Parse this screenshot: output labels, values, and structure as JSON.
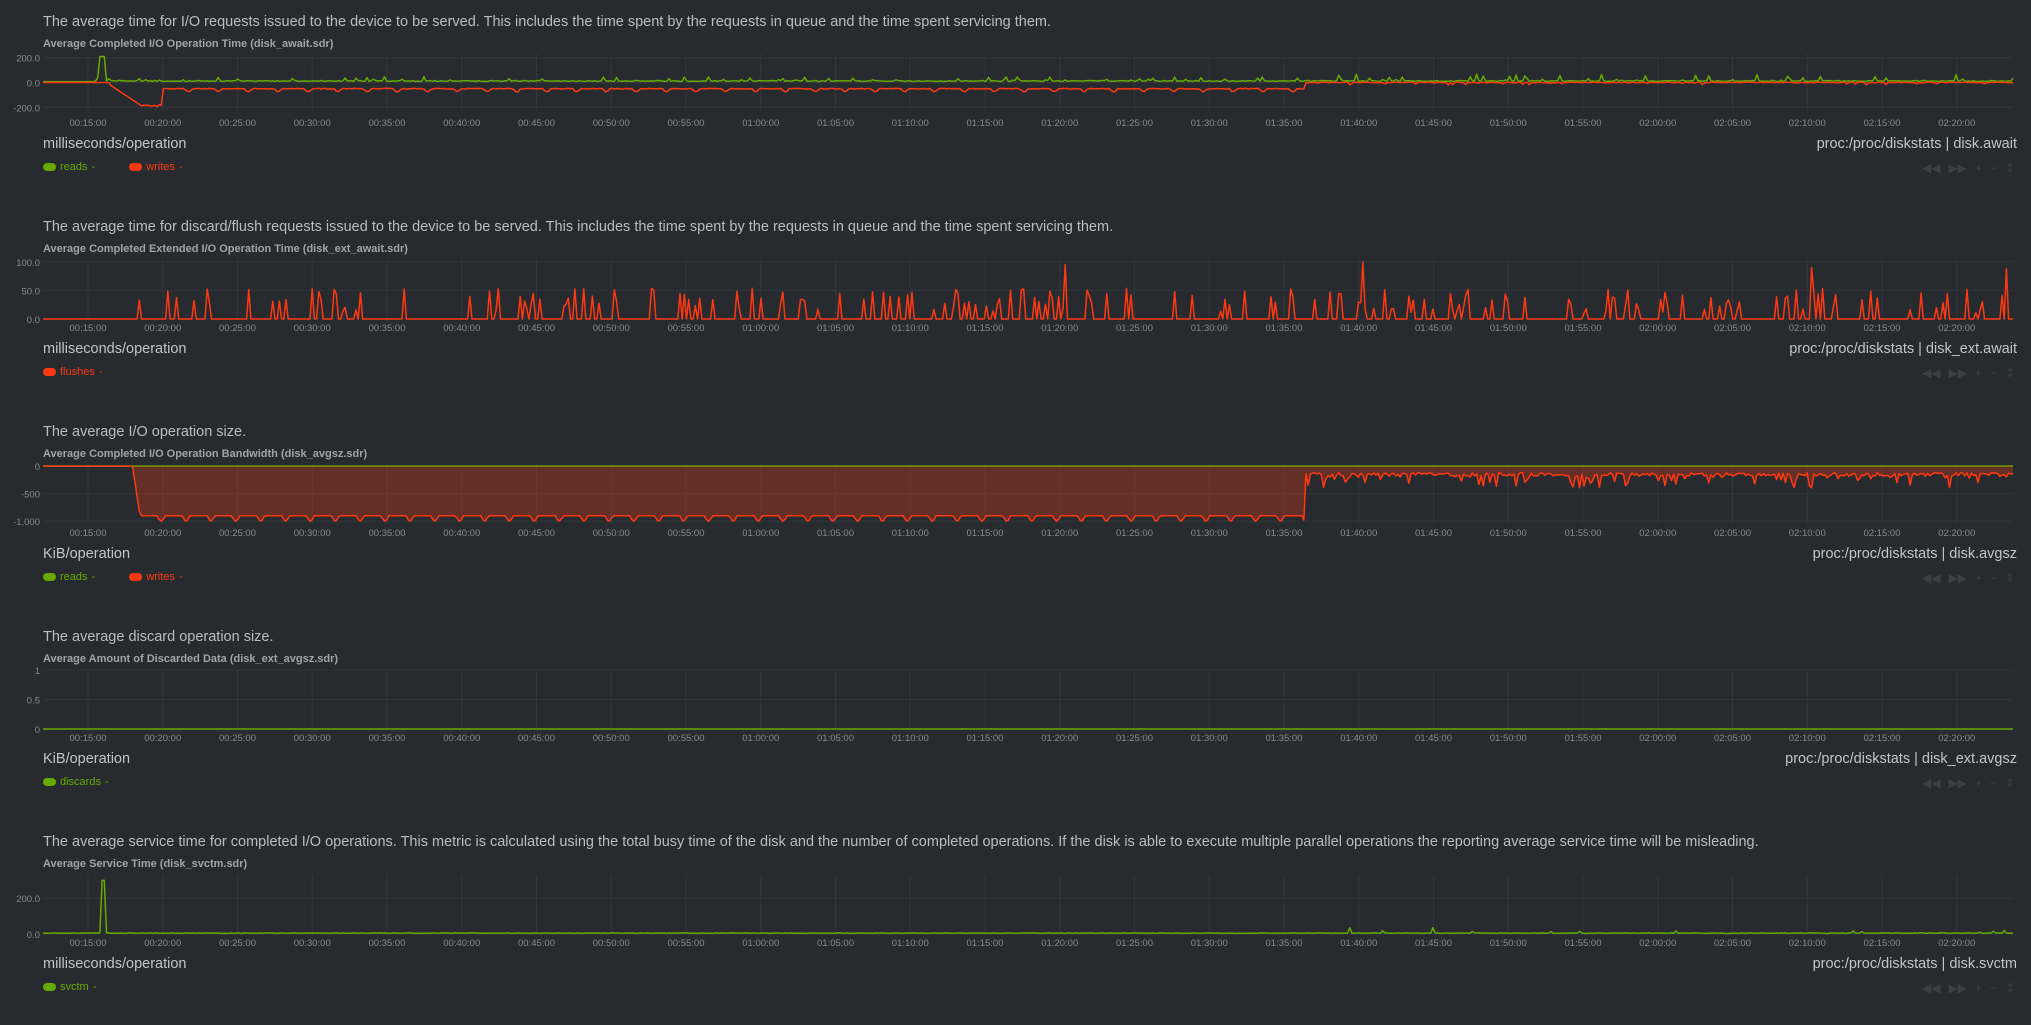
{
  "time_ticks": [
    "00:15:00",
    "00:20:00",
    "00:25:00",
    "00:30:00",
    "00:35:00",
    "00:40:00",
    "00:45:00",
    "00:50:00",
    "00:55:00",
    "01:00:00",
    "01:05:00",
    "01:10:00",
    "01:15:00",
    "01:20:00",
    "01:25:00",
    "01:30:00",
    "01:35:00",
    "01:40:00",
    "01:45:00",
    "01:50:00",
    "01:55:00",
    "02:00:00",
    "02:05:00",
    "02:10:00",
    "02:15:00",
    "02:20:00"
  ],
  "colors": {
    "background": "#272b30",
    "green": "#66aa00",
    "red": "#fe3912",
    "grid": "#32363b",
    "tick_text": "#8a8a8a",
    "title_text": "#a3a3a3"
  },
  "nav_buttons": [
    "rewind-icon",
    "fast-forward-icon",
    "zoom-in-icon",
    "zoom-out-icon",
    "resize-icon"
  ],
  "charts": [
    {
      "id": "disk_await",
      "description": "The average time for I/O requests issued to the device to be served. This includes the time spent by the requests in queue and the time spent servicing them.",
      "title": "Average Completed I/O Operation Time (disk_await.sdr)",
      "units": "milliseconds/operation",
      "context": "proc:/proc/diskstats | disk.await",
      "legend": [
        {
          "name": "reads",
          "color": "#66aa00"
        },
        {
          "name": "writes",
          "color": "#fe3912"
        }
      ],
      "y_ticks": [
        "200.0",
        "0.0",
        "-200.0"
      ]
    },
    {
      "id": "disk_ext_await",
      "description": "The average time for discard/flush requests issued to the device to be served. This includes the time spent by the requests in queue and the time spent servicing them.",
      "title": "Average Completed Extended I/O Operation Time (disk_ext_await.sdr)",
      "units": "milliseconds/operation",
      "context": "proc:/proc/diskstats | disk_ext.await",
      "legend": [
        {
          "name": "flushes",
          "color": "#fe3912"
        }
      ],
      "y_ticks": [
        "100.0",
        "50.0",
        "0.0"
      ]
    },
    {
      "id": "disk_avgsz",
      "description": "The average I/O operation size.",
      "title": "Average Completed I/O Operation Bandwidth (disk_avgsz.sdr)",
      "units": "KiB/operation",
      "context": "proc:/proc/diskstats | disk.avgsz",
      "legend": [
        {
          "name": "reads",
          "color": "#66aa00"
        },
        {
          "name": "writes",
          "color": "#fe3912"
        }
      ],
      "y_ticks": [
        "0",
        "-500",
        "-1,000"
      ]
    },
    {
      "id": "disk_ext_avgsz",
      "description": "The average discard operation size.",
      "title": "Average Amount of Discarded Data (disk_ext_avgsz.sdr)",
      "units": "KiB/operation",
      "context": "proc:/proc/diskstats | disk_ext.avgsz",
      "legend": [
        {
          "name": "discards",
          "color": "#66aa00"
        }
      ],
      "y_ticks": [
        "1",
        "0.5",
        "0"
      ]
    },
    {
      "id": "disk_svctm",
      "description": "The average service time for completed I/O operations. This metric is calculated using the total busy time of the disk and the number of completed operations. If the disk is able to execute multiple parallel operations the reporting average service time will be misleading.",
      "title": "Average Service Time (disk_svctm.sdr)",
      "units": "milliseconds/operation",
      "context": "proc:/proc/diskstats | disk.svctm",
      "legend": [
        {
          "name": "svctm",
          "color": "#66aa00"
        }
      ],
      "y_ticks": [
        "200.0",
        "0.0"
      ]
    }
  ],
  "chart_data": [
    {
      "type": "line",
      "title": "Average Completed I/O Operation Time (disk_await.sdr)",
      "ylabel": "milliseconds/operation",
      "x_range": [
        "00:11:30",
        "02:23:30"
      ],
      "ylim": [
        -230,
        230
      ],
      "grid": true,
      "legend_position": "bottom-left",
      "series": [
        {
          "name": "reads",
          "color": "#66aa00",
          "summary": {
            "baseline": 12,
            "spike": {
              "x": "00:15:30",
              "y": 210
            },
            "typical_peak_before_01:36": 35,
            "typical_peak_after_01:36": 55,
            "max_after_01:36": 70
          }
        },
        {
          "name": "writes",
          "color": "#fe3912",
          "summary": {
            "level_00:11_to_00:16": 0,
            "min": {
              "x": "00:18:30",
              "y": -200
            },
            "baseline_00:20_to_01:36": -50,
            "dip_amplitude": -25,
            "level_after_01:36": 0,
            "dip_after_01:36": -20
          }
        }
      ]
    },
    {
      "type": "line",
      "title": "Average Completed Extended I/O Operation Time (disk_ext_await.sdr)",
      "ylabel": "milliseconds/operation",
      "x_range": [
        "00:11:30",
        "02:23:30"
      ],
      "ylim": [
        0,
        105
      ],
      "grid": true,
      "legend_position": "bottom-left",
      "series": [
        {
          "name": "flushes",
          "color": "#fe3912",
          "summary": {
            "baseline": 0,
            "typical_spike": 45,
            "frequent_spikes_from": "00:16:00",
            "max": {
              "x": "01:40:00",
              "y": 100
            },
            "other_high_spikes": [
              {
                "x": "01:20:00",
                "y": 95
              },
              {
                "x": "02:10:00",
                "y": 90
              },
              {
                "x": "02:23:00",
                "y": 88
              }
            ]
          }
        }
      ]
    },
    {
      "type": "area",
      "title": "Average Completed I/O Operation Bandwidth (disk_avgsz.sdr)",
      "ylabel": "KiB/operation",
      "x_range": [
        "00:11:30",
        "02:23:30"
      ],
      "ylim": [
        -1050,
        20
      ],
      "grid": true,
      "legend_position": "bottom-left",
      "series": [
        {
          "name": "reads",
          "color": "#66aa00",
          "summary": {
            "level": 0
          }
        },
        {
          "name": "writes",
          "color": "#fe3912",
          "summary": {
            "level_00:11_to_00:17": 0,
            "level_00:18_to_01:36": -900,
            "dip_to": -1000,
            "level_after_01:36": -150,
            "dip_after_01:36": -400
          }
        }
      ]
    },
    {
      "type": "line",
      "title": "Average Amount of Discarded Data (disk_ext_avgsz.sdr)",
      "ylabel": "KiB/operation",
      "x_range": [
        "00:11:30",
        "02:23:30"
      ],
      "ylim": [
        0,
        1
      ],
      "grid": true,
      "legend_position": "bottom-left",
      "series": [
        {
          "name": "discards",
          "color": "#66aa00",
          "summary": {
            "level": 0
          }
        }
      ]
    },
    {
      "type": "line",
      "title": "Average Service Time (disk_svctm.sdr)",
      "ylabel": "milliseconds/operation",
      "x_range": [
        "00:11:30",
        "02:23:30"
      ],
      "ylim": [
        0,
        330
      ],
      "grid": true,
      "legend_position": "bottom-left",
      "series": [
        {
          "name": "svctm",
          "color": "#66aa00",
          "summary": {
            "baseline": 5,
            "spike": {
              "x": "00:15:30",
              "y": 300
            },
            "typical_peak_after_01:36": 20,
            "max_after_01:36": 35
          }
        }
      ]
    }
  ]
}
